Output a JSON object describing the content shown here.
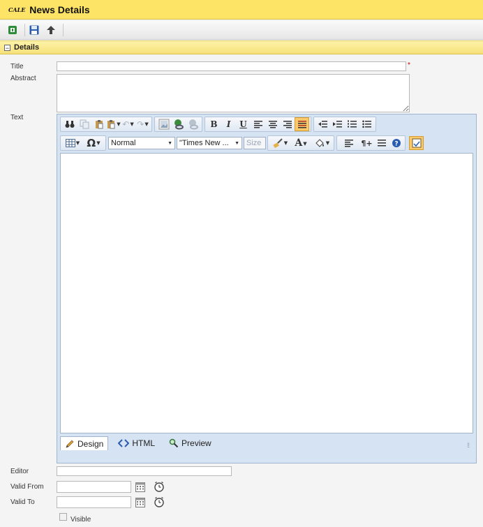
{
  "window": {
    "logo_text": "CALE",
    "title": "News Details"
  },
  "toolbar": {
    "buttons": [
      {
        "name": "new-button",
        "icon": "new-record-icon"
      },
      {
        "name": "save-button",
        "icon": "save-icon"
      },
      {
        "name": "back-button",
        "icon": "up-arrow-icon"
      }
    ]
  },
  "section": {
    "label": "Details",
    "collapse_symbol": "−"
  },
  "form": {
    "title_label": "Title",
    "title_value": "",
    "required_mark": "*",
    "abstract_label": "Abstract",
    "abstract_value": "",
    "text_label": "Text",
    "editor_label": "Editor",
    "editor_value": "",
    "valid_from_label": "Valid From",
    "valid_from_value": "",
    "valid_to_label": "Valid To",
    "valid_to_value": "",
    "visible_label": "Visible",
    "visible_checked": false
  },
  "rich_editor": {
    "paragraph_style": "Normal",
    "font_name": "\"Times New ...",
    "font_size": "Size",
    "modes": [
      {
        "label": "Design",
        "icon": "pencil-icon",
        "active": true
      },
      {
        "label": "HTML",
        "icon": "code-icon",
        "active": false
      },
      {
        "label": "Preview",
        "icon": "magnifier-icon",
        "active": false
      }
    ],
    "grip": "⁞⁞",
    "buttons": {
      "bold": "B",
      "italic": "I",
      "underline": "U",
      "omega": "Ω",
      "font_color": "A",
      "paragraph": "¶+"
    }
  },
  "colors": {
    "title_bar": "#fde466",
    "section_bar": "#f6e07a",
    "editor_bg": "#d6e3f2",
    "required": "#cc0000"
  }
}
